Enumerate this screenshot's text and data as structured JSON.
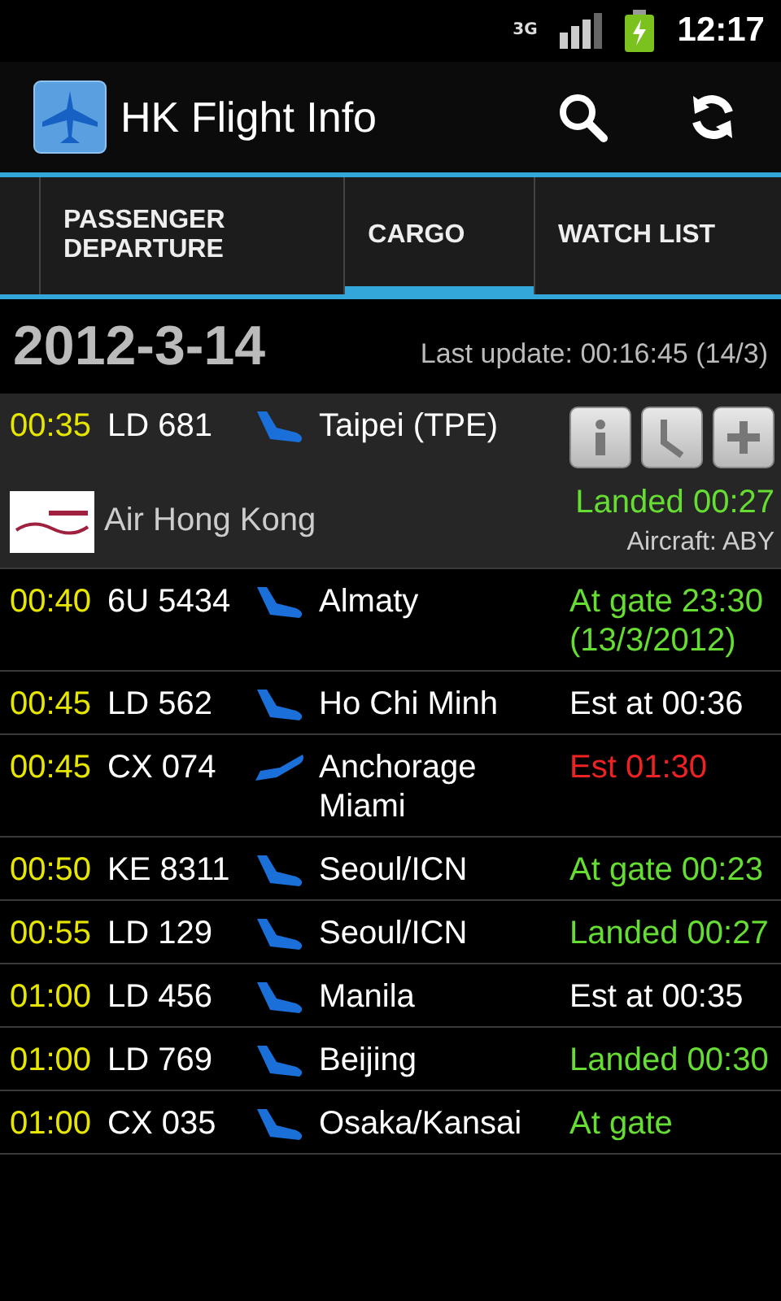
{
  "status_bar": {
    "network": "3G",
    "time": "12:17"
  },
  "app_bar": {
    "title": "HK Flight Info"
  },
  "tabs": [
    {
      "label": "PASSENGER DEPARTURE",
      "selected": false
    },
    {
      "label": "CARGO",
      "selected": true
    },
    {
      "label": "WATCH LIST",
      "selected": false
    }
  ],
  "date": "2012-3-14",
  "last_update": "Last update: 00:16:45 (14/3)",
  "flights": [
    {
      "time": "00:35",
      "flight": "LD 681",
      "kind": "arrival",
      "place": [
        "Taipei (TPE)"
      ],
      "status": "Landed 00:27",
      "color": "#66dd33",
      "expanded": true,
      "airline": "Air Hong Kong",
      "aircraft": "Aircraft: ABY"
    },
    {
      "time": "00:40",
      "flight": "6U 5434",
      "kind": "arrival",
      "place": [
        "Almaty"
      ],
      "status": "At gate 23:30 (13/3/2012)",
      "color": "#66dd33",
      "expanded": false
    },
    {
      "time": "00:45",
      "flight": "LD 562",
      "kind": "arrival",
      "place": [
        "Ho Chi Minh"
      ],
      "status": "Est at 00:36",
      "color": "#ffffff",
      "expanded": false
    },
    {
      "time": "00:45",
      "flight": "CX 074",
      "kind": "departure",
      "place": [
        "Anchorage",
        "Miami"
      ],
      "status": "Est 01:30",
      "color": "#ee2222",
      "expanded": false
    },
    {
      "time": "00:50",
      "flight": "KE 8311",
      "kind": "arrival",
      "place": [
        "Seoul/ICN"
      ],
      "status": "At gate 00:23",
      "color": "#66dd33",
      "expanded": false
    },
    {
      "time": "00:55",
      "flight": "LD 129",
      "kind": "arrival",
      "place": [
        "Seoul/ICN"
      ],
      "status": "Landed 00:27",
      "color": "#66dd33",
      "expanded": false
    },
    {
      "time": "01:00",
      "flight": "LD 456",
      "kind": "arrival",
      "place": [
        "Manila"
      ],
      "status": "Est at 00:35",
      "color": "#ffffff",
      "expanded": false
    },
    {
      "time": "01:00",
      "flight": "LD 769",
      "kind": "arrival",
      "place": [
        "Beijing"
      ],
      "status": "Landed 00:30",
      "color": "#66dd33",
      "expanded": false
    },
    {
      "time": "01:00",
      "flight": "CX 035",
      "kind": "arrival",
      "place": [
        "Osaka/Kansai"
      ],
      "status": "At gate",
      "color": "#66dd33",
      "expanded": false
    }
  ]
}
